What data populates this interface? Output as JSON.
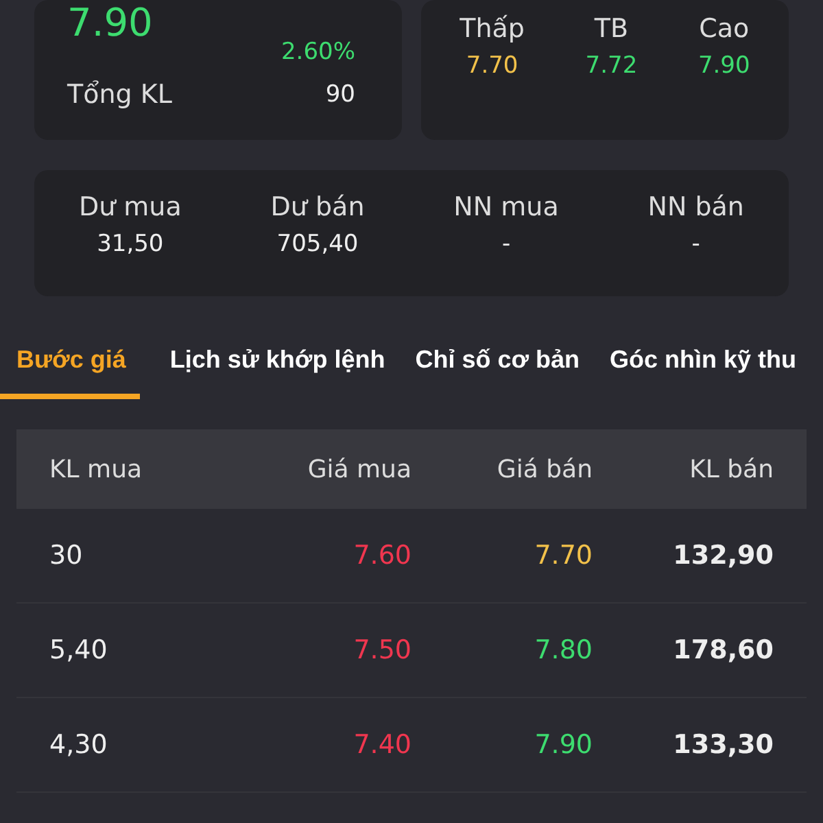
{
  "price_card": {
    "price": {
      "text": "7.90",
      "color": "#3ddc6f"
    },
    "change_percent": {
      "text": "2.60%",
      "color": "#3ddc6f"
    },
    "total_volume_label": "Tổng KL",
    "total_volume": "90"
  },
  "range_card": [
    {
      "label": "Thấp",
      "value": "7.70",
      "color": "#f2c14a"
    },
    {
      "label": "TB",
      "value": "7.72",
      "color": "#3ddc6f"
    },
    {
      "label": "Cao",
      "value": "7.90",
      "color": "#3ddc6f"
    }
  ],
  "order_card": [
    {
      "label": "Dư mua",
      "value": "31,50"
    },
    {
      "label": "Dư bán",
      "value": "705,40"
    },
    {
      "label": "NN mua",
      "value": "-"
    },
    {
      "label": "NN bán",
      "value": "-"
    }
  ],
  "tabs": [
    {
      "label": "Bước giá",
      "selected": true
    },
    {
      "label": "Lịch sử khớp lệnh",
      "selected": false
    },
    {
      "label": "Chỉ số cơ bản",
      "selected": false
    },
    {
      "label": "Góc nhìn kỹ thu",
      "selected": false
    }
  ],
  "table": {
    "columns": [
      "KL mua",
      "Giá mua",
      "Giá bán",
      "KL bán"
    ],
    "rows": [
      {
        "bid_volume": "30",
        "bid_price": {
          "text": "7.60",
          "color": "#f0364f"
        },
        "ask_price": {
          "text": "7.70",
          "color": "#f2c14a"
        },
        "ask_volume": "132,90"
      },
      {
        "bid_volume": "5,40",
        "bid_price": {
          "text": "7.50",
          "color": "#f0364f"
        },
        "ask_price": {
          "text": "7.80",
          "color": "#3ddc6f"
        },
        "ask_volume": "178,60"
      },
      {
        "bid_volume": "4,30",
        "bid_price": {
          "text": "7.40",
          "color": "#f0364f"
        },
        "ask_price": {
          "text": "7.90",
          "color": "#3ddc6f"
        },
        "ask_volume": "133,30"
      }
    ]
  }
}
